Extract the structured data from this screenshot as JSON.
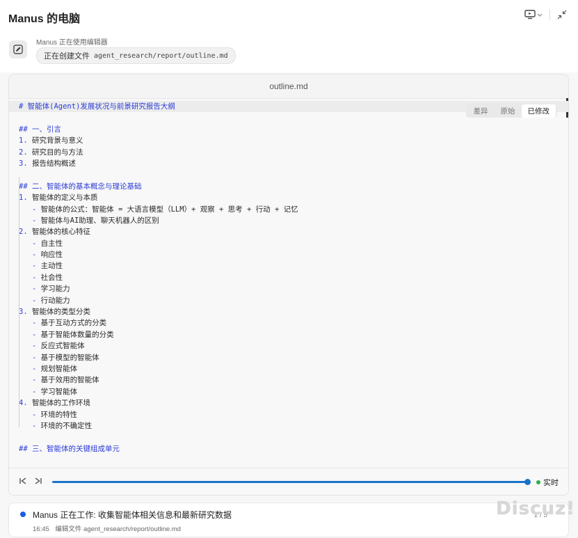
{
  "header": {
    "title": "Manus 的电脑"
  },
  "status": {
    "label": "Manus 正在使用编辑器",
    "action": "正在创建文件",
    "path": "agent_research/report/outline.md"
  },
  "editor": {
    "filename": "outline.md",
    "tabs": [
      "差异",
      "原始",
      "已修改"
    ],
    "active_tab": "已修改",
    "lines": [
      {
        "t": "# 智能体(Agent)发展状况与前景研究报告大纲",
        "k": "h1"
      },
      {
        "t": "",
        "k": "blank"
      },
      {
        "t": "## 一、引言",
        "k": "h2"
      },
      {
        "t": "1. 研究背景与意义",
        "k": "item"
      },
      {
        "t": "2. 研究目的与方法",
        "k": "item"
      },
      {
        "t": "3. 报告结构概述",
        "k": "item"
      },
      {
        "t": "",
        "k": "blank"
      },
      {
        "t": "## 二、智能体的基本概念与理论基础",
        "k": "h2"
      },
      {
        "t": "1. 智能体的定义与本质",
        "k": "item"
      },
      {
        "t": "   - 智能体的公式：智能体 = 大语言模型（LLM）+ 观察 + 思考 + 行动 + 记忆",
        "k": "sub"
      },
      {
        "t": "   - 智能体与AI助理、聊天机器人的区别",
        "k": "sub"
      },
      {
        "t": "2. 智能体的核心特征",
        "k": "item"
      },
      {
        "t": "   - 自主性",
        "k": "sub"
      },
      {
        "t": "   - 响应性",
        "k": "sub"
      },
      {
        "t": "   - 主动性",
        "k": "sub"
      },
      {
        "t": "   - 社会性",
        "k": "sub"
      },
      {
        "t": "   - 学习能力",
        "k": "sub"
      },
      {
        "t": "   - 行动能力",
        "k": "sub"
      },
      {
        "t": "3. 智能体的类型分类",
        "k": "item"
      },
      {
        "t": "   - 基于互动方式的分类",
        "k": "sub"
      },
      {
        "t": "   - 基于智能体数量的分类",
        "k": "sub"
      },
      {
        "t": "   - 反应式智能体",
        "k": "sub"
      },
      {
        "t": "   - 基于模型的智能体",
        "k": "sub"
      },
      {
        "t": "   - 规划智能体",
        "k": "sub"
      },
      {
        "t": "   - 基于效用的智能体",
        "k": "sub"
      },
      {
        "t": "   - 学习智能体",
        "k": "sub"
      },
      {
        "t": "4. 智能体的工作环境",
        "k": "item"
      },
      {
        "t": "   - 环境的特性",
        "k": "sub"
      },
      {
        "t": "   - 环境的不确定性",
        "k": "sub"
      },
      {
        "t": "",
        "k": "blank"
      },
      {
        "t": "## 三、智能体的关键组成单元",
        "k": "h2"
      }
    ]
  },
  "playback": {
    "progress": 1.0,
    "live_label": "实时"
  },
  "task": {
    "title": "Manus 正在工作: 收集智能体相关信息和最新研究数据",
    "time": "16:45",
    "detail": "编辑文件 agent_research/report/outline.md",
    "count": "1 / 5"
  },
  "watermark": "Discuz!",
  "colors": {
    "accent": "#1a73c8",
    "heading": "#2b3cd6",
    "live": "#2bb24c",
    "task_dot": "#1b5fe0"
  }
}
